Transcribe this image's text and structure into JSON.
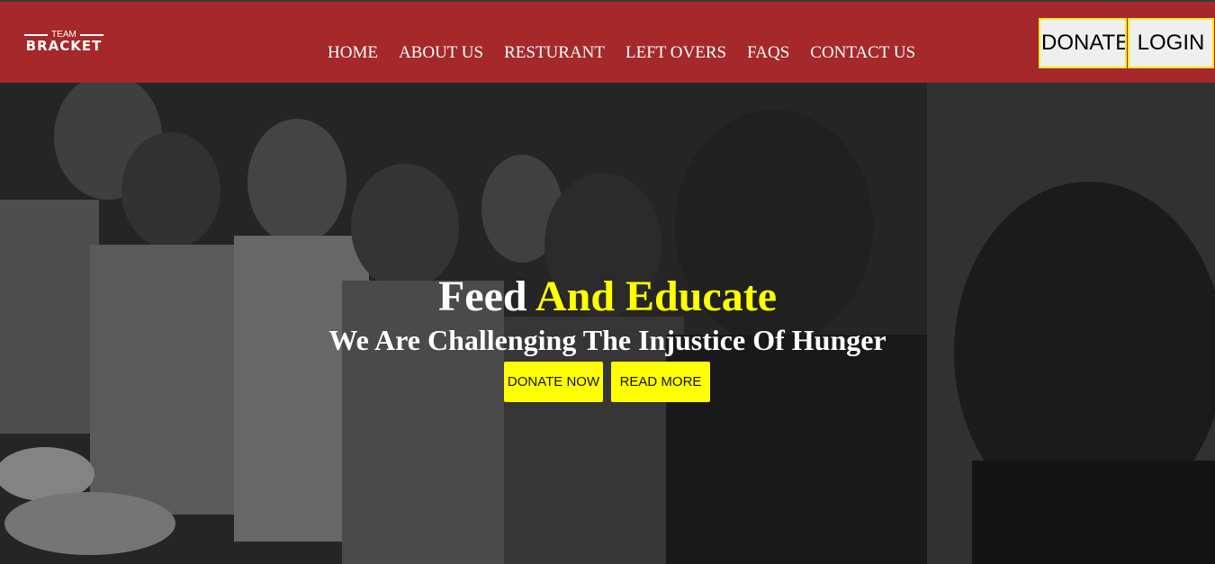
{
  "logo": {
    "top": "TEAM",
    "bottom": "BRACKET"
  },
  "nav": {
    "items": [
      {
        "label": "HOME"
      },
      {
        "label": "ABOUT US"
      },
      {
        "label": "RESTURANT"
      },
      {
        "label": "LEFT OVERS"
      },
      {
        "label": "FAQS"
      },
      {
        "label": "CONTACT US"
      }
    ]
  },
  "header_buttons": {
    "donate": "DONATE",
    "login": "LOGIN"
  },
  "hero": {
    "title_part1": "Feed",
    "title_part2": "And Educate",
    "subtitle": "We Are Challenging The Injustice Of Hunger",
    "donate_now": "DONATE NOW",
    "read_more": "READ MORE"
  },
  "colors": {
    "header_bg": "#a5282a",
    "accent_yellow": "#ffff00",
    "button_border": "#f5ea27"
  }
}
